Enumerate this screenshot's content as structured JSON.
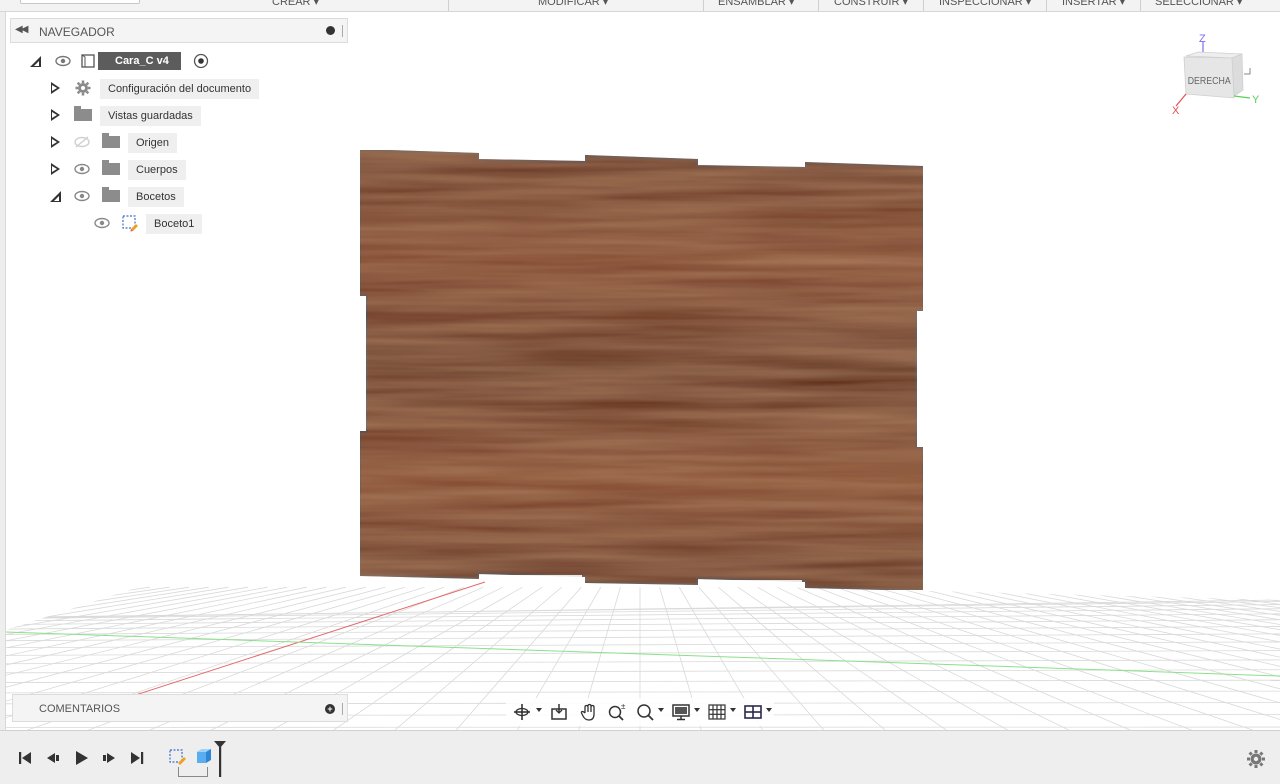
{
  "toolbar": {
    "menus": [
      {
        "label": "CREAR ▾"
      },
      {
        "label": "MODIFICAR ▾"
      },
      {
        "label": "ENSAMBLAR ▾"
      },
      {
        "label": "CONSTRUIR ▾"
      },
      {
        "label": "INSPECCIONAR ▾"
      },
      {
        "label": "INSERTAR ▾"
      },
      {
        "label": "SELECCIONAR ▾"
      }
    ]
  },
  "navigator": {
    "title": "NAVEGADOR",
    "root": {
      "label": "Cara_C v4"
    },
    "items": [
      {
        "label": "Configuración del documento",
        "icon": "gear-icon"
      },
      {
        "label": "Vistas guardadas",
        "icon": "folder-icon"
      },
      {
        "label": "Origen",
        "icon": "folder-icon",
        "visible": false
      },
      {
        "label": "Cuerpos",
        "icon": "folder-icon",
        "visible": true
      },
      {
        "label": "Bocetos",
        "icon": "folder-icon",
        "visible": true,
        "expanded": true
      }
    ],
    "sketch": {
      "label": "Boceto1",
      "icon": "sketch-icon"
    }
  },
  "viewcube": {
    "face_label": "DERECHA",
    "axis_z": "Z",
    "axis_x": "X",
    "axis_y": "Y",
    "color_z": "#7b6cf0",
    "color_x": "#e05050",
    "color_y": "#5bd05b"
  },
  "comments": {
    "title": "COMENTARIOS"
  },
  "navbar": {
    "tools": [
      "orbit-icon",
      "look-at-icon",
      "pan-icon",
      "zoom-icon",
      "fit-icon",
      "display-settings-icon",
      "grid-settings-icon",
      "viewports-icon"
    ]
  },
  "timeline": {
    "controls": [
      "first-icon",
      "previous-icon",
      "play-icon",
      "next-icon",
      "last-icon"
    ],
    "features": [
      "sketch-feature-icon",
      "extrude-feature-icon"
    ]
  },
  "colors": {
    "wood": "#6b3521",
    "wood_light": "#8a4a2c",
    "wood_dark": "#4a2416",
    "grid": "#d9d9d9"
  }
}
